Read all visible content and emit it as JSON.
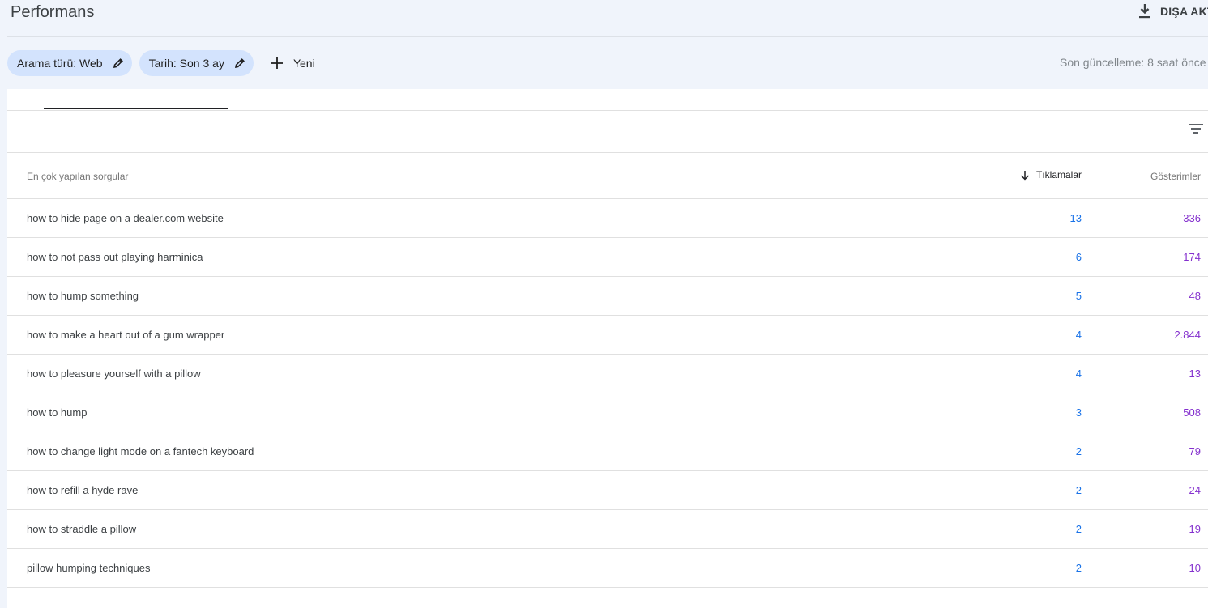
{
  "header": {
    "title": "Performans",
    "export_label": "DIŞA AKTAR"
  },
  "filters": {
    "chips": [
      {
        "label": "Arama türü: Web"
      },
      {
        "label": "Tarih: Son 3 ay"
      }
    ],
    "new_label": "Yeni",
    "last_update": "Son güncelleme: 8 saat önce"
  },
  "table": {
    "columns": {
      "query": "En çok yapılan sorgular",
      "clicks": "Tıklamalar",
      "impressions": "Gösterimler"
    },
    "rows": [
      {
        "query": "how to hide page on a dealer.com website",
        "clicks": "13",
        "impressions": "336"
      },
      {
        "query": "how to not pass out playing harminica",
        "clicks": "6",
        "impressions": "174"
      },
      {
        "query": "how to hump something",
        "clicks": "5",
        "impressions": "48"
      },
      {
        "query": "how to make a heart out of a gum wrapper",
        "clicks": "4",
        "impressions": "2.844"
      },
      {
        "query": "how to pleasure yourself with a pillow",
        "clicks": "4",
        "impressions": "13"
      },
      {
        "query": "how to hump",
        "clicks": "3",
        "impressions": "508"
      },
      {
        "query": "how to change light mode on a fantech keyboard",
        "clicks": "2",
        "impressions": "79"
      },
      {
        "query": "how to refill a hyde rave",
        "clicks": "2",
        "impressions": "24"
      },
      {
        "query": "how to straddle a pillow",
        "clicks": "2",
        "impressions": "19"
      },
      {
        "query": "pillow humping techniques",
        "clicks": "2",
        "impressions": "10"
      }
    ]
  },
  "colors": {
    "clicks": "#1a73e8",
    "impressions": "#8430ce",
    "chip_bg": "#d3e3fd"
  },
  "icons": {
    "export": "download-icon",
    "edit": "pencil-icon",
    "add": "plus-icon",
    "filter": "filter-list-icon",
    "sort": "arrow-down-icon"
  }
}
